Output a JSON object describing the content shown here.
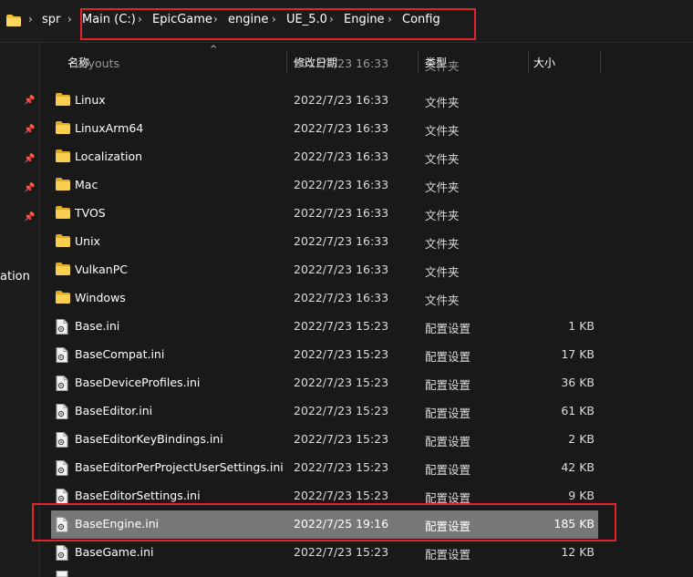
{
  "breadcrumb": {
    "items": [
      "spr",
      "Main (C:)",
      "EpicGame",
      "engine",
      "UE_5.0",
      "Engine",
      "Config"
    ]
  },
  "left_nav": {
    "partial_label": "ation"
  },
  "columns": {
    "name": "名称",
    "date": "修改日期",
    "type": "类型",
    "size": "大小"
  },
  "partial_row": {
    "name": "Layouts",
    "date": "2022/7/23 16:33",
    "type": "文件夹"
  },
  "rows": [
    {
      "name": "Linux",
      "date": "2022/7/23 16:33",
      "type": "文件夹",
      "size": "",
      "kind": "folder"
    },
    {
      "name": "LinuxArm64",
      "date": "2022/7/23 16:33",
      "type": "文件夹",
      "size": "",
      "kind": "folder"
    },
    {
      "name": "Localization",
      "date": "2022/7/23 16:33",
      "type": "文件夹",
      "size": "",
      "kind": "folder"
    },
    {
      "name": "Mac",
      "date": "2022/7/23 16:33",
      "type": "文件夹",
      "size": "",
      "kind": "folder"
    },
    {
      "name": "TVOS",
      "date": "2022/7/23 16:33",
      "type": "文件夹",
      "size": "",
      "kind": "folder"
    },
    {
      "name": "Unix",
      "date": "2022/7/23 16:33",
      "type": "文件夹",
      "size": "",
      "kind": "folder"
    },
    {
      "name": "VulkanPC",
      "date": "2022/7/23 16:33",
      "type": "文件夹",
      "size": "",
      "kind": "folder"
    },
    {
      "name": "Windows",
      "date": "2022/7/23 16:33",
      "type": "文件夹",
      "size": "",
      "kind": "folder"
    },
    {
      "name": "Base.ini",
      "date": "2022/7/23 15:23",
      "type": "配置设置",
      "size": "1 KB",
      "kind": "file"
    },
    {
      "name": "BaseCompat.ini",
      "date": "2022/7/23 15:23",
      "type": "配置设置",
      "size": "17 KB",
      "kind": "file"
    },
    {
      "name": "BaseDeviceProfiles.ini",
      "date": "2022/7/23 15:23",
      "type": "配置设置",
      "size": "36 KB",
      "kind": "file"
    },
    {
      "name": "BaseEditor.ini",
      "date": "2022/7/23 15:23",
      "type": "配置设置",
      "size": "61 KB",
      "kind": "file"
    },
    {
      "name": "BaseEditorKeyBindings.ini",
      "date": "2022/7/23 15:23",
      "type": "配置设置",
      "size": "2 KB",
      "kind": "file"
    },
    {
      "name": "BaseEditorPerProjectUserSettings.ini",
      "date": "2022/7/23 15:23",
      "type": "配置设置",
      "size": "42 KB",
      "kind": "file"
    },
    {
      "name": "BaseEditorSettings.ini",
      "date": "2022/7/23 15:23",
      "type": "配置设置",
      "size": "9 KB",
      "kind": "file"
    },
    {
      "name": "BaseEngine.ini",
      "date": "2022/7/25 19:16",
      "type": "配置设置",
      "size": "185 KB",
      "kind": "file",
      "selected": true
    },
    {
      "name": "BaseGame.ini",
      "date": "2022/7/23 15:23",
      "type": "配置设置",
      "size": "12 KB",
      "kind": "file"
    }
  ],
  "colors": {
    "background": "#191919",
    "selected_row": "#777777",
    "highlight_box": "#e0242b",
    "folder_yellow": "#f3c233"
  }
}
